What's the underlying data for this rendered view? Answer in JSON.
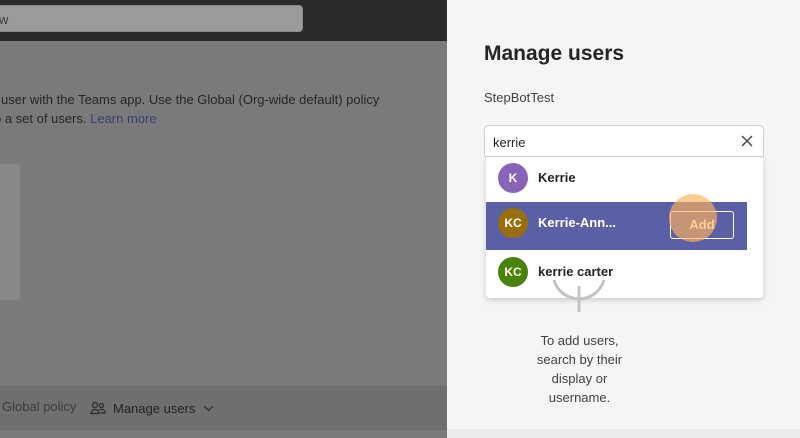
{
  "background_page": {
    "search_value": "w",
    "description_line1": "user with the Teams app. Use the Global (Org-wide default) policy",
    "description_line2": "o a set of users. ",
    "learn_more": "Learn more",
    "footer": {
      "global_policy_label": "Global policy",
      "manage_users_label": "Manage users",
      "icons": [
        "users-icon",
        "chevron-down-icon"
      ]
    }
  },
  "panel": {
    "title": "Manage users",
    "subtitle": "StepBotTest",
    "search": {
      "value": "kerrie",
      "clear_icon": "close-icon"
    },
    "results": [
      {
        "initials": "K",
        "name": "Kerrie",
        "color": "#8764b8",
        "selected": false
      },
      {
        "initials": "KC",
        "name": "Kerrie-Ann...",
        "color": "#986f0b",
        "selected": true,
        "action_label": "Add"
      },
      {
        "initials": "KC",
        "name": "kerrie carter",
        "color": "#498205",
        "selected": false
      }
    ],
    "empty_state": {
      "icon": "info-circle-icon",
      "line1": "To add users,",
      "line2": "search by their",
      "line3": "display or",
      "line4": "username."
    }
  },
  "colors": {
    "accent": "#5b5fa6",
    "click_highlight": "#ffb25a"
  }
}
